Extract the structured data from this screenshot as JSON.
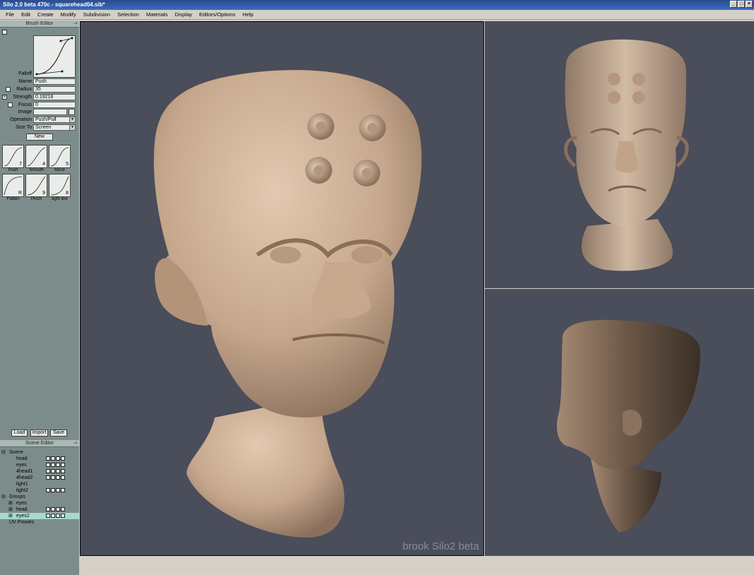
{
  "window": {
    "title": "Silo 2.0 beta 470c - squarehead04.sib*",
    "buttons": [
      "_",
      "□",
      "×"
    ]
  },
  "menu": [
    "File",
    "Edit",
    "Create",
    "Modify",
    "Subdivision",
    "Selection",
    "Materials",
    "Display",
    "Editors/Options",
    "Help"
  ],
  "brush_editor": {
    "title": "Brush Editor",
    "falloff_label": "Falloff",
    "name_label": "Name",
    "name_value": "Push",
    "radius_label": "Radius",
    "radius_value": "35",
    "strength_label": "Strength",
    "strength_value": "0.19218",
    "focus_label": "Focus",
    "focus_value": "0",
    "image_label": "Image",
    "image_value": "",
    "operation_label": "Operation",
    "operation_value": "Push/Pull",
    "sizeto_label": "Size To",
    "sizeto_value": "Screen",
    "new_button": "New",
    "brushes": [
      {
        "label": "Push",
        "num": "7"
      },
      {
        "label": "Smooth",
        "num": "4"
      },
      {
        "label": "Move",
        "num": "5"
      },
      {
        "label": "Flatten",
        "num": "R"
      },
      {
        "label": "Pinch",
        "num": "9"
      },
      {
        "label": "tight line",
        "num": "8"
      }
    ],
    "load_button": "Load",
    "import_button": "Import",
    "save_button": "Save"
  },
  "scene_editor": {
    "title": "Scene Editor",
    "items": [
      {
        "name": "Scene",
        "indent": 0,
        "expander": "⊟"
      },
      {
        "name": "head",
        "indent": 2
      },
      {
        "name": "eyes",
        "indent": 2
      },
      {
        "name": "4head1",
        "indent": 2
      },
      {
        "name": "4head2",
        "indent": 2
      },
      {
        "name": "light1",
        "indent": 2
      },
      {
        "name": "light2",
        "indent": 2
      },
      {
        "name": "Groups",
        "indent": 0,
        "expander": "⊟"
      },
      {
        "name": "eyes",
        "indent": 1,
        "expander": "⊞"
      },
      {
        "name": "head",
        "indent": 1,
        "expander": "⊞"
      },
      {
        "name": "eyes2",
        "indent": 1,
        "expander": "⊞"
      },
      {
        "name": "UV Proxies",
        "indent": 1
      }
    ]
  },
  "viewport": {
    "watermark": "brook Silo2 beta",
    "background": "#4a4d5a",
    "model_color": "#c4a88e"
  }
}
